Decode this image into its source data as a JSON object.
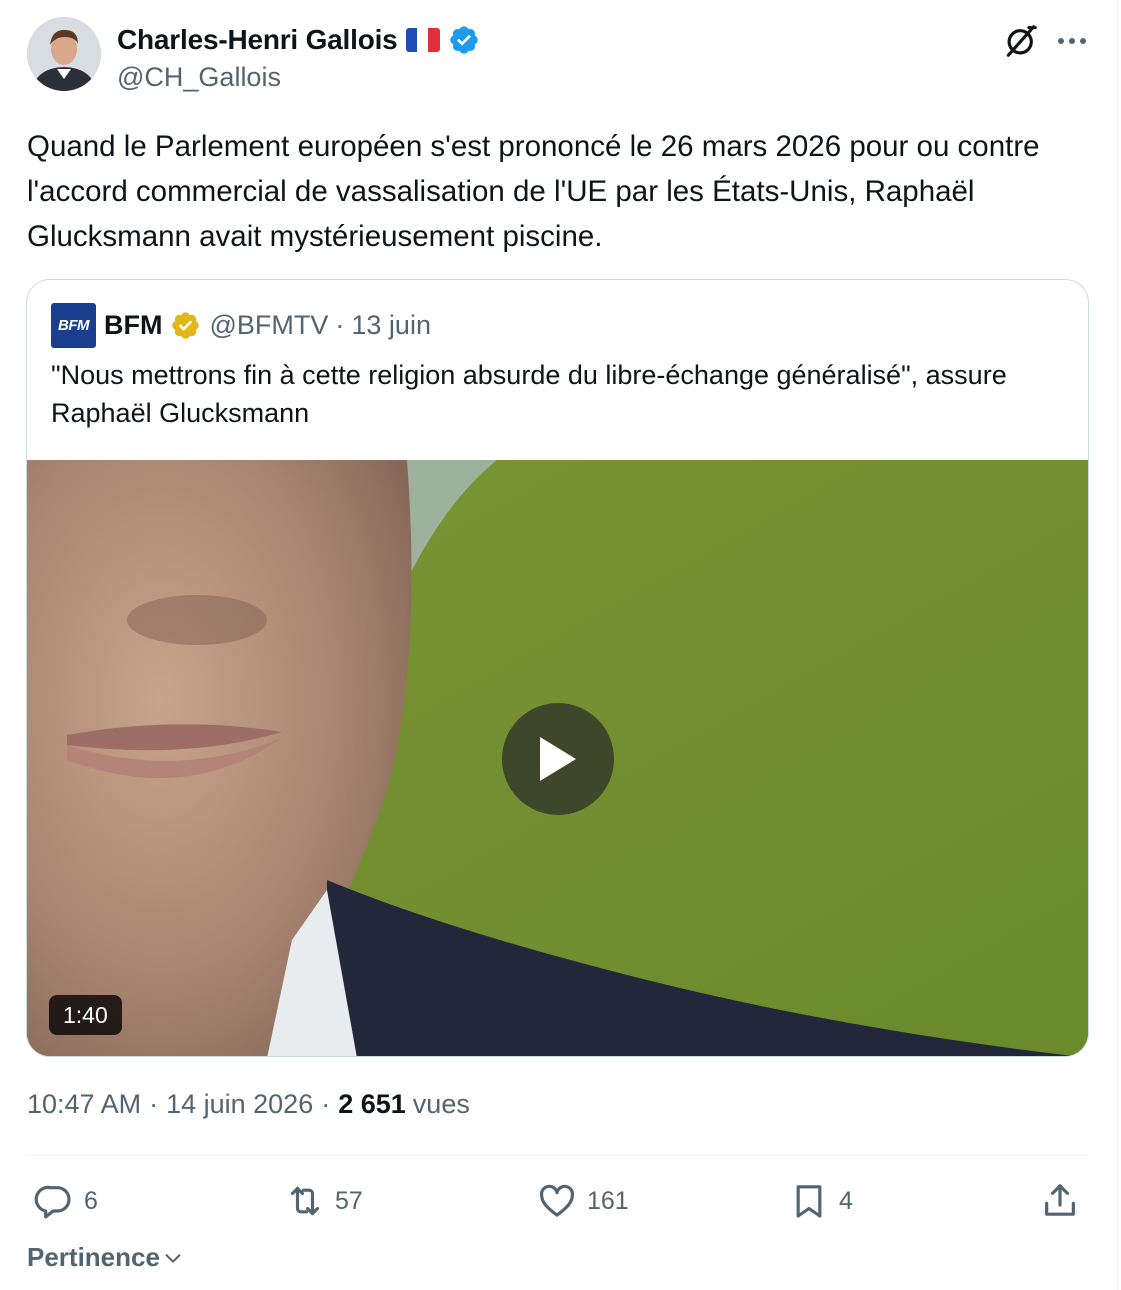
{
  "author": {
    "name": "Charles-Henri Gallois",
    "handle": "@CH_Gallois",
    "flag": "france-flag",
    "verified_color": "#1d9bf0"
  },
  "post": {
    "text": "Quand le Parlement européen s'est prononcé le 26 mars 2026 pour ou contre l'accord commercial de vassalisation de l'UE par les États-Unis, Raphaël Glucksmann avait mystérieusement piscine."
  },
  "quoted": {
    "logo_text": "BFM",
    "name": "BFM",
    "handle": "@BFMTV",
    "separator": "·",
    "date": "13 juin",
    "text": "\"Nous mettrons fin à cette religion absurde du libre-échange généralisé\", assure Raphaël Glucksmann",
    "badge_color": "#e2b719",
    "video": {
      "duration": "1:40"
    }
  },
  "meta": {
    "time": "10:47 AM",
    "separator": "·",
    "date": "14 juin 2026",
    "views_count": "2 651",
    "views_label": "vues"
  },
  "actions": {
    "replies": "6",
    "reposts": "57",
    "likes": "161",
    "bookmarks": "4"
  },
  "sort": {
    "label": "Pertinence"
  },
  "colors": {
    "text": "#0f1419",
    "secondary": "#536471",
    "border": "#cfd9de",
    "accent": "#1d9bf0"
  }
}
